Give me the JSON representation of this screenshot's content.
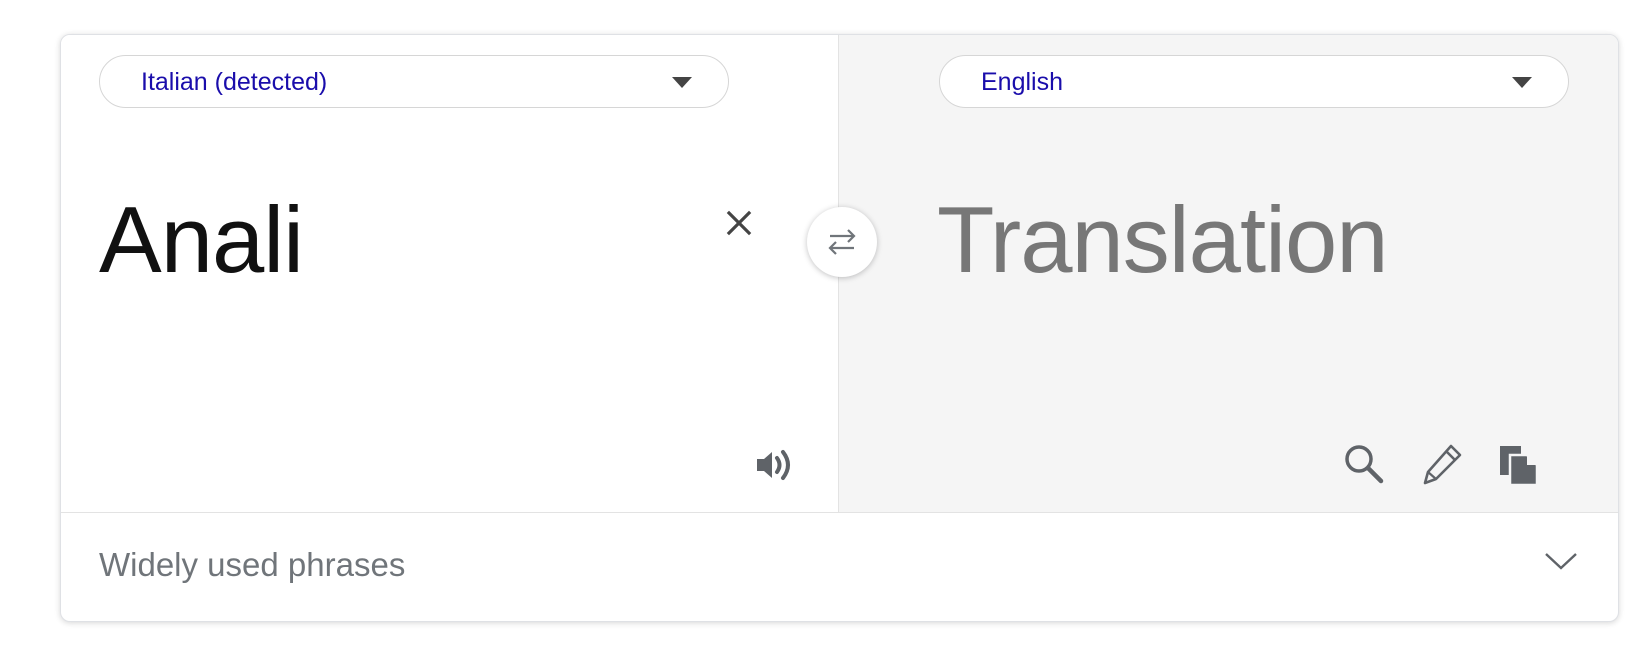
{
  "source_language": {
    "label": "Italian (detected)"
  },
  "target_language": {
    "label": "English"
  },
  "source": {
    "text": "Anali"
  },
  "target": {
    "placeholder": "Translation"
  },
  "icons": {
    "clear": "close-icon",
    "speak": "speaker-icon",
    "swap": "swap-arrows-icon",
    "search": "search-icon",
    "edit": "pencil-icon",
    "copy": "copy-icon",
    "expand": "chevron-down-icon"
  },
  "phrases_section": {
    "label": "Widely used phrases"
  },
  "colors": {
    "link": "#1a0dab",
    "source_text": "#111111",
    "placeholder_text": "#777777",
    "output_panel_bg": "#f5f5f5",
    "icon": "#5f6368"
  }
}
